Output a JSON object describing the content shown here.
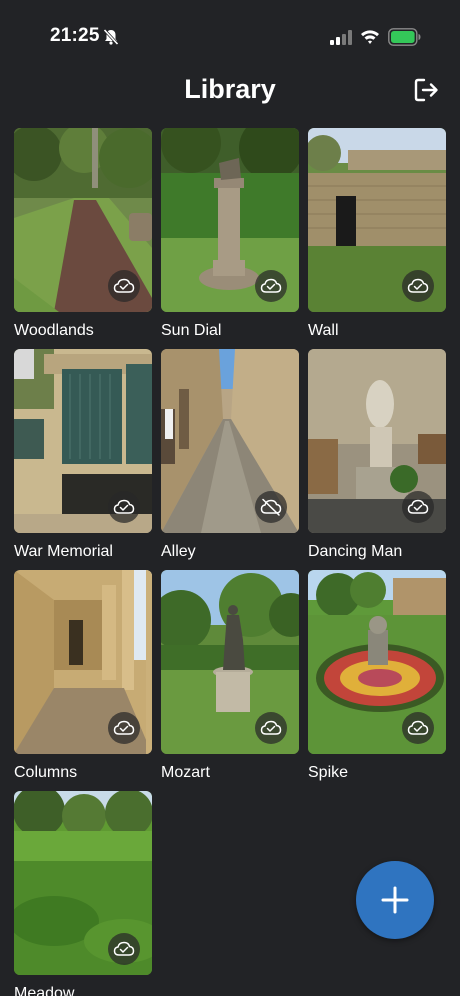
{
  "status_bar": {
    "time": "21:25",
    "mute_icon": "bell-slash-icon",
    "signal_icon": "cellular-signal-icon",
    "wifi_icon": "wifi-icon",
    "battery_icon": "battery-icon",
    "battery_color": "#34c759"
  },
  "header": {
    "title": "Library",
    "signout_icon": "sign-out-icon"
  },
  "tiles": [
    {
      "label": "Woodlands",
      "sync_status": "cloud-check-icon"
    },
    {
      "label": "Sun Dial",
      "sync_status": "cloud-check-icon"
    },
    {
      "label": "Wall",
      "sync_status": "cloud-check-icon"
    },
    {
      "label": "War Memorial",
      "sync_status": "cloud-check-icon"
    },
    {
      "label": "Alley",
      "sync_status": "cloud-slash-icon"
    },
    {
      "label": "Dancing Man",
      "sync_status": "cloud-check-icon"
    },
    {
      "label": "Columns",
      "sync_status": "cloud-check-icon"
    },
    {
      "label": "Mozart",
      "sync_status": "cloud-check-icon"
    },
    {
      "label": "Spike",
      "sync_status": "cloud-check-icon"
    },
    {
      "label": "Meadow",
      "sync_status": "cloud-check-icon"
    }
  ],
  "fab": {
    "icon": "plus-icon",
    "color": "#2f74c0"
  }
}
